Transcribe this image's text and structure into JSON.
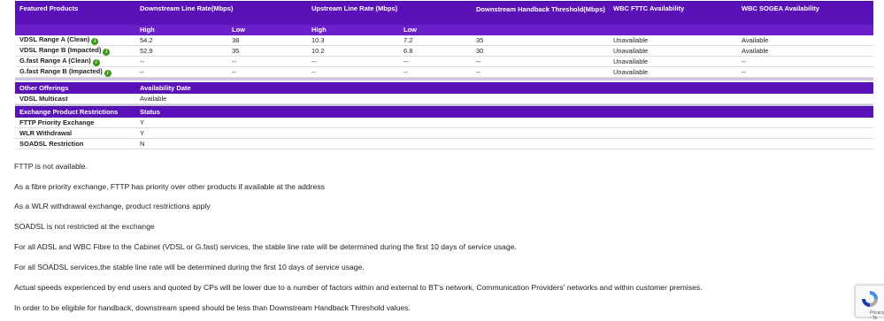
{
  "featured_table": {
    "headers": {
      "col1": "Featured Products",
      "col2": "Downstream Line Rate(Mbps)",
      "col3": "Upstream Line Rate (Mbps)",
      "col4": "Downstream Handback Threshold(Mbps)",
      "col5": "WBC FTTC Availability",
      "col6": "WBC SOGEA Availability"
    },
    "subheaders": {
      "down_high": "High",
      "down_low": "Low",
      "up_high": "High",
      "up_low": "Low"
    },
    "rows": [
      {
        "product": "VDSL Range A (Clean)",
        "dh": "54.2",
        "dl": "38",
        "uh": "10.3",
        "ul": "7.2",
        "thr": "35",
        "fttc": "Unavailable",
        "sogea": "Available"
      },
      {
        "product": "VDSL Range B (Impacted)",
        "dh": "52.9",
        "dl": "35",
        "uh": "10.2",
        "ul": "6.8",
        "thr": "30",
        "fttc": "Unavailable",
        "sogea": "Available"
      },
      {
        "product": "G.fast Range A (Clean)",
        "dh": "--",
        "dl": "--",
        "uh": "--",
        "ul": "--",
        "thr": "--",
        "fttc": "Unavailable",
        "sogea": "--"
      },
      {
        "product": "G.fast Range B (Impacted)",
        "dh": "--",
        "dl": "--",
        "uh": "--",
        "ul": "--",
        "thr": "--",
        "fttc": "Unavailable",
        "sogea": "--"
      }
    ]
  },
  "other_offerings": {
    "header": "Other Offerings",
    "header_value": "Availability Date",
    "rows": [
      {
        "label": "VDSL Multicast",
        "value": "Available"
      }
    ]
  },
  "restrictions": {
    "header": "Exchange Product Restrictions",
    "header_value": "Status",
    "rows": [
      {
        "label": "FTTP Priority Exchange",
        "value": "Y"
      },
      {
        "label": "WLR Withdrawal",
        "value": "Y"
      },
      {
        "label": "SOADSL Restriction",
        "value": "N"
      }
    ]
  },
  "notes": [
    "FTTP is not available.",
    "As a fibre priority exchange, FTTP has priority over other products if available at the address",
    "As a WLR withdrawal exchange, product restrictions apply",
    "SOADSL is not restricted at the exchange",
    "For all ADSL and WBC Fibre to the Cabinet (VDSL or G.fast) services, the stable line rate will be determined during the first 10 days of service usage.",
    "For all SOADSL services,the stable line rate will be determined during the first 10 days of service usage.",
    "Actual speeds experienced by end users and quoted by CPs will be lower due to a number of factors within and external to BT's network, Communication Providers' networks and within customer premises.",
    "In order to be eligible for handback, downstream speed should be less than Downstream Handback Threshold values."
  ],
  "colors": {
    "header_purple": "#5a12b8",
    "info_icon_green": "#3e9a1c"
  },
  "icons": {
    "info": "info-icon",
    "recaptcha": "recaptcha-icon"
  },
  "captcha": {
    "text": "Privacy - Te"
  }
}
